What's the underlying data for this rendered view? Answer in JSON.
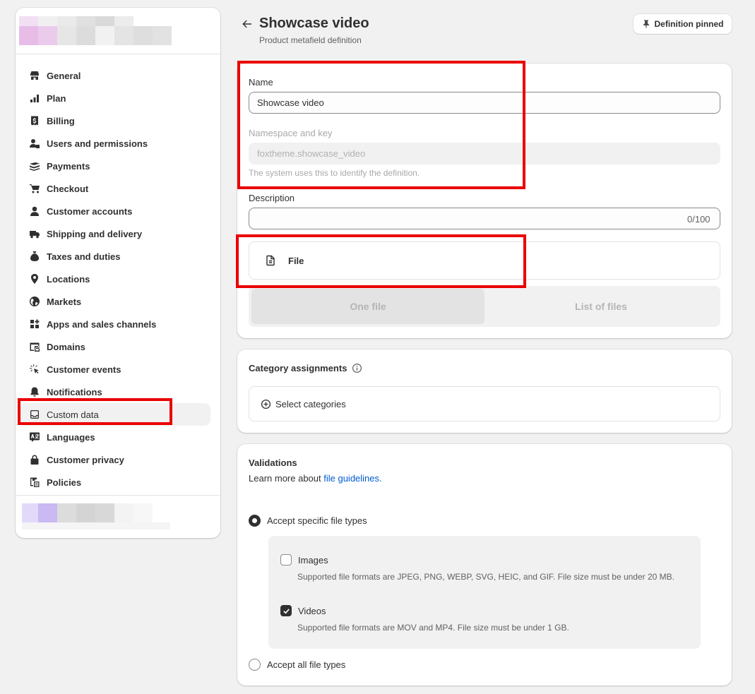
{
  "sidebar": {
    "items": [
      {
        "label": "General",
        "icon": "store-icon"
      },
      {
        "label": "Plan",
        "icon": "plan-icon"
      },
      {
        "label": "Billing",
        "icon": "billing-icon"
      },
      {
        "label": "Users and permissions",
        "icon": "users-icon"
      },
      {
        "label": "Payments",
        "icon": "payments-icon"
      },
      {
        "label": "Checkout",
        "icon": "cart-icon"
      },
      {
        "label": "Customer accounts",
        "icon": "person-icon"
      },
      {
        "label": "Shipping and delivery",
        "icon": "truck-icon"
      },
      {
        "label": "Taxes and duties",
        "icon": "tax-icon"
      },
      {
        "label": "Locations",
        "icon": "location-icon"
      },
      {
        "label": "Markets",
        "icon": "globe-icon"
      },
      {
        "label": "Apps and sales channels",
        "icon": "apps-icon"
      },
      {
        "label": "Domains",
        "icon": "domain-icon"
      },
      {
        "label": "Customer events",
        "icon": "cursor-icon"
      },
      {
        "label": "Notifications",
        "icon": "bell-icon"
      },
      {
        "label": "Custom data",
        "icon": "custom-data-icon",
        "active": true
      },
      {
        "label": "Languages",
        "icon": "language-icon"
      },
      {
        "label": "Customer privacy",
        "icon": "lock-icon"
      },
      {
        "label": "Policies",
        "icon": "policies-icon"
      }
    ]
  },
  "header": {
    "title": "Showcase video",
    "subtitle": "Product metafield definition",
    "pin_button": "Definition pinned"
  },
  "definition": {
    "name_label": "Name",
    "name_value": "Showcase video",
    "namespace_label": "Namespace and key",
    "namespace_value": "foxtheme.showcase_video",
    "namespace_help": "The system uses this to identify the definition.",
    "description_label": "Description",
    "description_value": "",
    "description_counter": "0/100",
    "type_label": "File",
    "segments": [
      "One file",
      "List of files"
    ],
    "selected_segment": "One file"
  },
  "categories": {
    "heading": "Category assignments",
    "select_label": "Select categories"
  },
  "validations": {
    "heading": "Validations",
    "learn_prefix": "Learn more about ",
    "learn_link": "file guidelines.",
    "options": {
      "specific": "Accept specific file types",
      "all": "Accept all file types"
    },
    "selected_option": "specific",
    "file_types": [
      {
        "label": "Images",
        "checked": false,
        "help": "Supported file formats are JPEG, PNG, WEBP, SVG, HEIC, and GIF. File size must be under 20 MB."
      },
      {
        "label": "Videos",
        "checked": true,
        "help": "Supported file formats are MOV and MP4. File size must be under 1 GB."
      }
    ]
  },
  "colors": {
    "highlight": "#ea0000",
    "link": "#005bd3",
    "text": "#303030",
    "background": "#f1f1f1"
  }
}
